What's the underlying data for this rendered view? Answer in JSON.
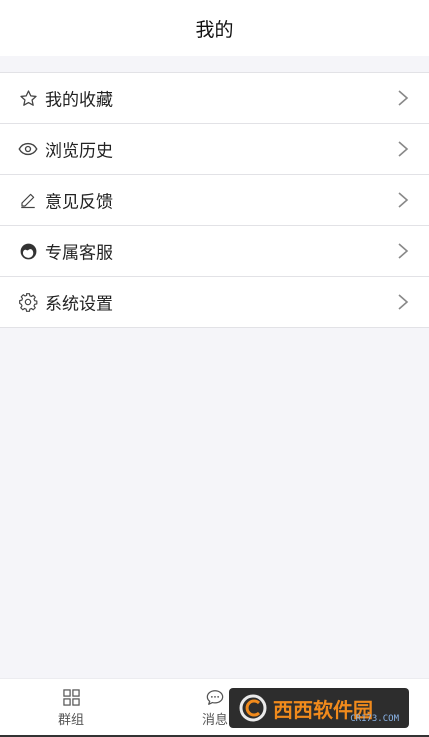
{
  "header": {
    "title": "我的"
  },
  "menu": {
    "items": [
      {
        "label": "我的收藏",
        "icon": "star-icon"
      },
      {
        "label": "浏览历史",
        "icon": "eye-icon"
      },
      {
        "label": "意见反馈",
        "icon": "pencil-icon"
      },
      {
        "label": "专属客服",
        "icon": "customer-service-icon"
      },
      {
        "label": "系统设置",
        "icon": "gear-icon"
      }
    ]
  },
  "tabbar": {
    "tabs": [
      {
        "label": "群组",
        "icon": "grid-icon"
      },
      {
        "label": "消息",
        "icon": "chat-bubble-icon"
      }
    ]
  },
  "watermark": {
    "text": "西西软件园",
    "sub": "CR173.COM"
  }
}
